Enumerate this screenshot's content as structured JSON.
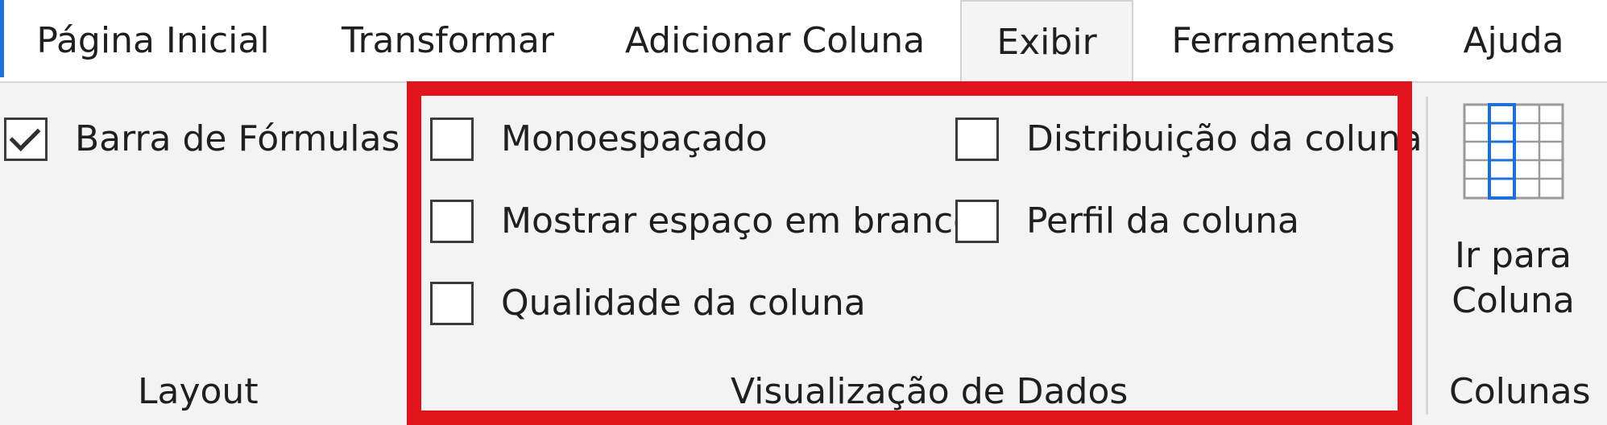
{
  "tabs": [
    "Página Inicial",
    "Transformar",
    "Adicionar Coluna",
    "Exibir",
    "Ferramentas",
    "Ajuda"
  ],
  "active_tab": "Exibir",
  "layout_group": {
    "formula_bar_label": "Barra de Fórmulas",
    "formula_bar_checked": true,
    "group_label": "Layout"
  },
  "data_preview_group": {
    "monospaced": {
      "label": "Monoespaçado",
      "checked": false
    },
    "show_whitespace": {
      "label": "Mostrar espaço em branco",
      "checked": false
    },
    "column_quality": {
      "label": "Qualidade da coluna",
      "checked": false
    },
    "column_distribution": {
      "label": "Distribuição da coluna",
      "checked": false
    },
    "column_profile": {
      "label": "Perfil da coluna",
      "checked": false
    },
    "group_label": "Visualização de Dados"
  },
  "columns_group": {
    "goto_line1": "Ir para",
    "goto_line2": "Coluna",
    "goto_icon": "go-to-column-icon",
    "group_label": "Colunas"
  },
  "colors": {
    "highlight": "#e1141c",
    "accent": "#1e6fd9"
  }
}
